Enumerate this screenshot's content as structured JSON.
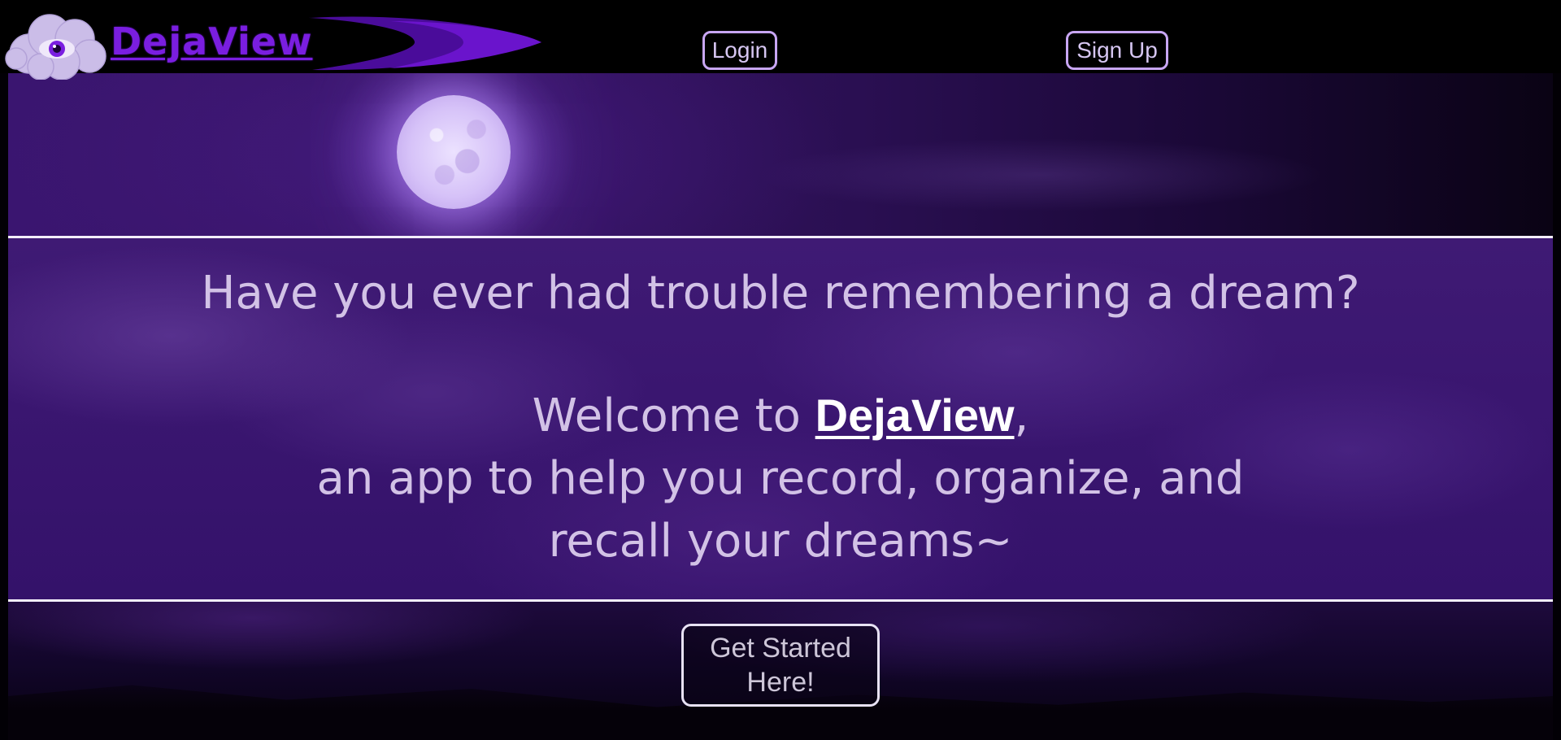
{
  "header": {
    "brand": "DejaView",
    "login_label": "Login",
    "signup_label": "Sign Up"
  },
  "hero": {
    "question": "Have you ever had trouble remembering a dream?",
    "welcome_prefix": "Welcome to ",
    "welcome_brand": "DejaView",
    "welcome_suffix": ",",
    "description_line1": "an app to help you record, organize, and",
    "description_line2": "recall your dreams~"
  },
  "cta": {
    "line1": "Get Started",
    "line2": "Here!"
  },
  "colors": {
    "brand_purple": "#7a1ee0",
    "button_border": "#c8a6f3",
    "hero_text": "#d2c2e6",
    "band_bg": "#3a1670"
  },
  "icons": {
    "logo": "eye-cloud-icon",
    "decoration": "swoosh-icon"
  }
}
